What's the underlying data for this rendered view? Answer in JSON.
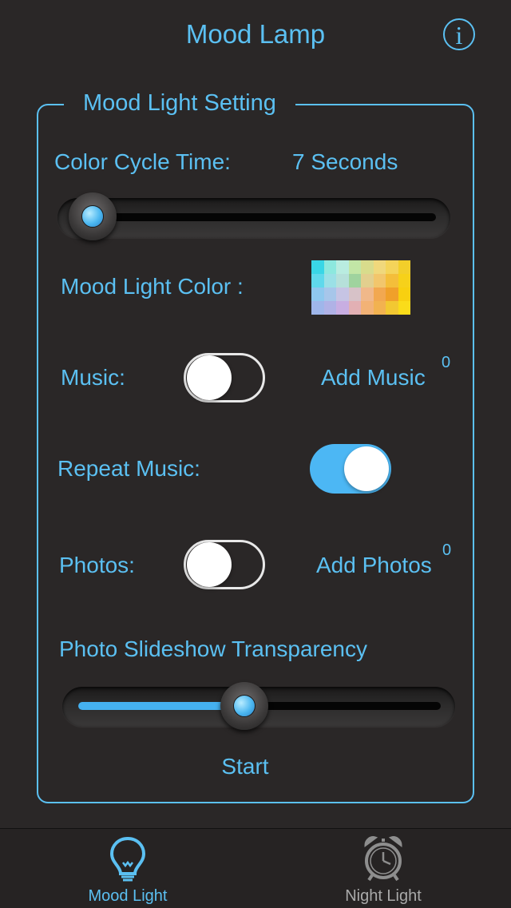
{
  "header": {
    "title": "Mood Lamp",
    "info_icon": "info-icon",
    "info_glyph": "i"
  },
  "panel": {
    "title": "Mood Light Setting",
    "color_cycle": {
      "label": "Color Cycle Time:",
      "value": "7 Seconds",
      "slider_fraction": 0.0
    },
    "mood_color": {
      "label": "Mood Light Color :"
    },
    "music": {
      "label": "Music:",
      "on": false,
      "add_label": "Add Music",
      "count": "0"
    },
    "repeat_music": {
      "label": "Repeat Music:",
      "on": true
    },
    "photos": {
      "label": "Photos:",
      "on": false,
      "add_label": "Add Photos",
      "count": "0"
    },
    "transparency": {
      "label": "Photo Slideshow Transparency",
      "slider_fraction": 0.45
    },
    "start_label": "Start"
  },
  "tabbar": {
    "tabs": [
      {
        "label": "Mood Light",
        "icon": "lightbulb-icon",
        "active": true
      },
      {
        "label": "Night Light",
        "icon": "alarm-clock-icon",
        "active": false
      }
    ]
  },
  "colors": {
    "accent": "#5bc0f2",
    "background": "#2a2727",
    "toggle_on": "#4cb7f4",
    "tab_inactive": "#a9a9a9"
  }
}
